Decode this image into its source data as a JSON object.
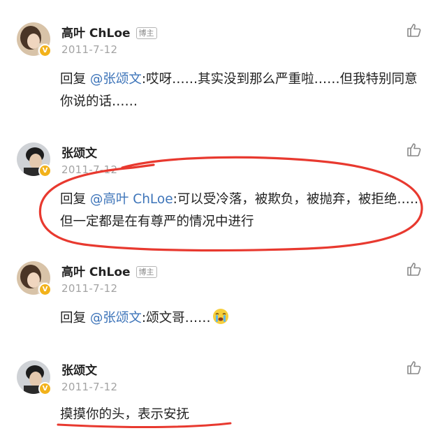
{
  "comments": [
    {
      "author": "高叶 ChLoe",
      "tag": "博主",
      "date": "2011-7-12",
      "reply_prefix": "回复 ",
      "mention": "@张颂文",
      "text": ":哎呀……其实没到那么严重啦……但我特别同意你说的话……",
      "avatar": "avatar-woman",
      "verified_badge": "V"
    },
    {
      "author": "张颂文",
      "date": "2011-7-12",
      "reply_prefix": "回复 ",
      "mention": "@高叶 ChLoe",
      "text": ":可以受冷落，被欺负，被抛弃，被拒绝……但一定都是在有尊严的情况中进行",
      "avatar": "avatar-man",
      "verified_badge": "V"
    },
    {
      "author": "高叶 ChLoe",
      "tag": "博主",
      "date": "2011-7-12",
      "reply_prefix": "回复 ",
      "mention": "@张颂文",
      "text": ":颂文哥……",
      "emoji": "crying-face-emoji",
      "avatar": "avatar-woman",
      "verified_badge": "V"
    },
    {
      "author": "张颂文",
      "date": "2011-7-12",
      "text": "摸摸你的头，表示安抚",
      "avatar": "avatar-man",
      "verified_badge": "V"
    }
  ],
  "colors": {
    "mention": "#3d74b9",
    "date": "#a3a3a3",
    "annotation": "#e8392f",
    "verified": "#f2b21b"
  },
  "icons": {
    "like": "thumbs-up-icon"
  }
}
